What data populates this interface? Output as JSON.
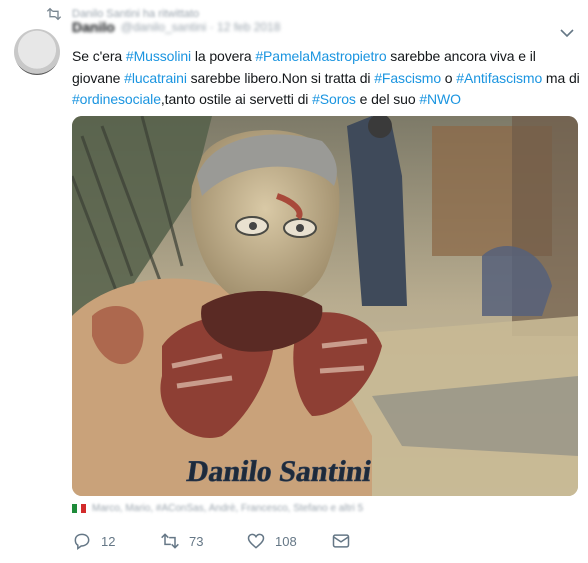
{
  "retweet_context": {
    "blurred_text": "Danilo Santini ha ritwittato"
  },
  "author": {
    "display_name": "Danilo",
    "handle": "@danilo_santini · 12 feb 2018"
  },
  "tweet": {
    "segments": [
      {
        "text": "Se c'era ",
        "tag": false
      },
      {
        "text": "#Mussolini",
        "tag": true
      },
      {
        "text": " la povera ",
        "tag": false
      },
      {
        "text": "#PamelaMastropietro",
        "tag": true
      },
      {
        "text": " sarebbe ancora viva e il giovane ",
        "tag": false
      },
      {
        "text": "#lucatraini",
        "tag": true
      },
      {
        "text": " sarebbe libero.Non si tratta di ",
        "tag": false
      },
      {
        "text": "#Fascismo",
        "tag": true
      },
      {
        "text": " o ",
        "tag": false
      },
      {
        "text": "#Antifascismo",
        "tag": true
      },
      {
        "text": " ma di ",
        "tag": false
      },
      {
        "text": "#ordinesociale",
        "tag": true
      },
      {
        "text": ",tanto ostile ai servetti di ",
        "tag": false
      },
      {
        "text": "#Soros",
        "tag": true
      },
      {
        "text": " e del suo ",
        "tag": false
      },
      {
        "text": "#NWO",
        "tag": true
      }
    ]
  },
  "media": {
    "signature": "Danilo Santini"
  },
  "card_row": {
    "blurred_text": "Marco, Mario, #AConSas, Andrè, Francesco, Stefano e altri 5"
  },
  "actions": {
    "reply_count": "12",
    "retweet_count": "73",
    "like_count": "108"
  },
  "colors": {
    "hashtag": "#1b95e0",
    "action_gray": "#657786",
    "text": "#14171a"
  },
  "icons": [
    "retweet-icon",
    "caret-down-icon",
    "reply-icon",
    "retweet-icon",
    "like-icon",
    "direct-message-icon",
    "italy-flag-icon"
  ]
}
